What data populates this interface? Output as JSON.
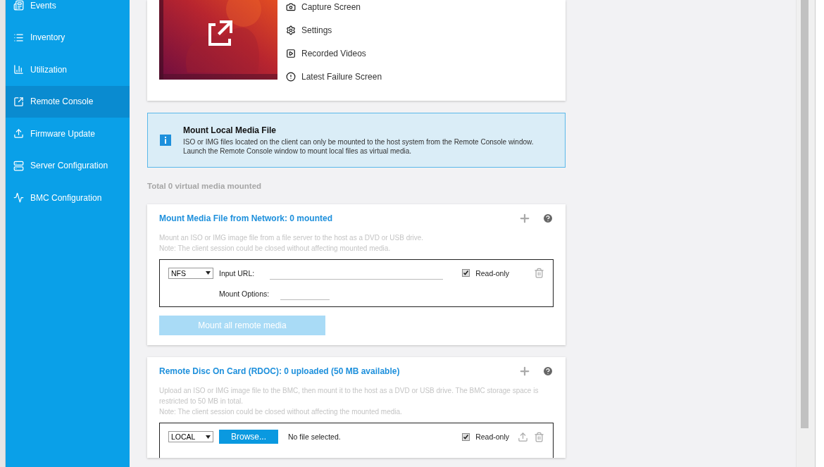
{
  "sidebar": {
    "items": [
      {
        "label": "Events",
        "selected": false
      },
      {
        "label": "Inventory",
        "selected": false
      },
      {
        "label": "Utilization",
        "selected": false
      },
      {
        "label": "Remote Console",
        "selected": true
      },
      {
        "label": "Firmware Update",
        "selected": false
      },
      {
        "label": "Server Configuration",
        "selected": false
      },
      {
        "label": "BMC Configuration",
        "selected": false
      }
    ]
  },
  "console_card": {
    "actions": [
      {
        "label": "Capture Screen"
      },
      {
        "label": "Settings"
      },
      {
        "label": "Recorded Videos"
      },
      {
        "label": "Latest Failure Screen"
      }
    ]
  },
  "info_box": {
    "title": "Mount Local Media File",
    "lines": [
      "ISO or IMG files located on the client can only be mounted to the host system from the Remote Console window.",
      "Launch the Remote Console window to mount local files as virtual media."
    ]
  },
  "total_mounted": "Total 0 virtual media mounted",
  "network_card": {
    "title": "Mount Media File from Network: 0 mounted",
    "description": [
      "Mount an ISO or IMG image file from a file server to the host as a DVD or USB drive.",
      "Note: The client session could be closed without affecting mounted media."
    ],
    "entry": {
      "protocol": "NFS",
      "url_label": "Input URL:",
      "options_label": "Mount Options:",
      "read_only_label": "Read-only",
      "read_only": true
    },
    "mount_button": {
      "label": "Mount all remote media",
      "disabled": true
    }
  },
  "rdoc_card": {
    "title": "Remote Disc On Card (RDOC): 0 uploaded (50 MB available)",
    "description": [
      "Upload an ISO or IMG image file to the BMC, then mount it to the host as a DVD or USB drive. The BMC storage space is restricted to 50 MB in total.",
      "Note: The client session could be closed without affecting the mounted media."
    ],
    "entry": {
      "source": "LOCAL",
      "browse_label": "Browse...",
      "file_status": "No file selected.",
      "read_only_label": "Read-only",
      "read_only": true
    }
  }
}
